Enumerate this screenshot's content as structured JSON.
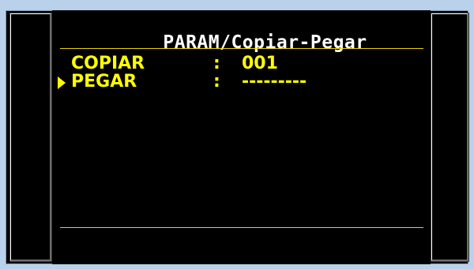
{
  "screen": {
    "title": "PARAM/Copiar-Pegar",
    "rows": [
      {
        "label": "COPIAR",
        "separator": ":",
        "value": "001",
        "selected": false
      },
      {
        "label": "PEGAR",
        "separator": ":",
        "value": "---------",
        "selected": true
      }
    ]
  },
  "colors": {
    "background": "#000000",
    "title": "#ffffff",
    "text": "#ffff00",
    "rule": "#e8d200",
    "frame": "#b9d1ea"
  },
  "icons": {
    "cursor": "selection-arrow-icon"
  }
}
